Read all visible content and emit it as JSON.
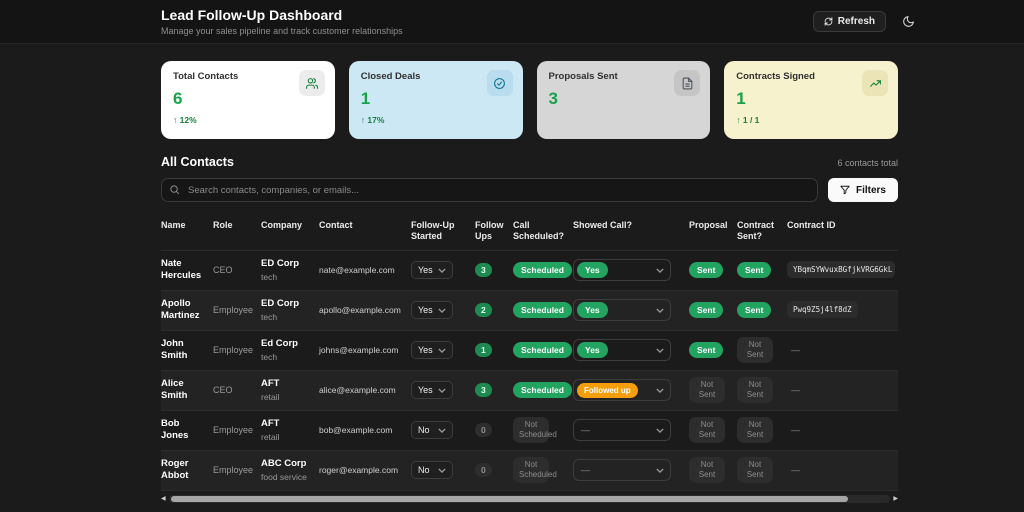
{
  "header": {
    "title": "Lead Follow-Up Dashboard",
    "subtitle": "Manage your sales pipeline and track customer relationships",
    "refresh_label": "Refresh"
  },
  "stats": [
    {
      "label": "Total Contacts",
      "value": "6",
      "delta": "↑ 12%",
      "bg": "#ffffff",
      "icon_bg": "#ececec",
      "icon": "users-icon"
    },
    {
      "label": "Closed Deals",
      "value": "1",
      "delta": "↑ 17%",
      "bg": "#cde8f5",
      "icon_bg": "#b9dcee",
      "icon": "check-circle-icon"
    },
    {
      "label": "Proposals Sent",
      "value": "3",
      "delta": "",
      "bg": "#d6d6d6",
      "icon_bg": "#c5c5c5",
      "icon": "document-icon"
    },
    {
      "label": "Contracts Signed",
      "value": "1",
      "delta": "↑ 1 / 1",
      "bg": "#f6f2cd",
      "icon_bg": "#ebe4b6",
      "icon": "trend-up-icon"
    }
  ],
  "contacts": {
    "section_title": "All Contacts",
    "count_label": "6 contacts total",
    "search_placeholder": "Search contacts, companies, or emails...",
    "filters_label": "Filters"
  },
  "table": {
    "columns": [
      "Name",
      "Role",
      "Company",
      "Contact",
      "Follow-Up Started",
      "Follow Ups",
      "Call Scheduled?",
      "Showed Call?",
      "Proposal",
      "Contract Sent?",
      "Contract ID"
    ],
    "rows": [
      {
        "name": "Nate Hercules",
        "role": "CEO",
        "company": "ED Corp",
        "company_sub": "tech",
        "email": "nate@example.com",
        "followup_started": "Yes",
        "followups": "3",
        "call_scheduled": "Scheduled",
        "showed_call": "Yes",
        "showed_call_variant": "green",
        "proposal": "Sent",
        "contract_sent": "Sent",
        "contract_id": "YBqmSYWvuxBGfjkVRG6GkL"
      },
      {
        "name": "Apollo Martinez",
        "role": "Employee",
        "company": "ED Corp",
        "company_sub": "tech",
        "email": "apollo@example.com",
        "followup_started": "Yes",
        "followups": "2",
        "call_scheduled": "Scheduled",
        "showed_call": "Yes",
        "showed_call_variant": "green",
        "proposal": "Sent",
        "contract_sent": "Sent",
        "contract_id": "Pwq9Z5j4lf8dZ"
      },
      {
        "name": "John Smith",
        "role": "Employee",
        "company": "Ed Corp",
        "company_sub": "tech",
        "email": "johns@example.com",
        "followup_started": "Yes",
        "followups": "1",
        "call_scheduled": "Scheduled",
        "showed_call": "Yes",
        "showed_call_variant": "green",
        "proposal": "Sent",
        "contract_sent": "Not Sent",
        "contract_id": ""
      },
      {
        "name": "Alice Smith",
        "role": "CEO",
        "company": "AFT",
        "company_sub": "retail",
        "email": "alice@example.com",
        "followup_started": "Yes",
        "followups": "3",
        "call_scheduled": "Scheduled",
        "showed_call": "Followed up",
        "showed_call_variant": "orange",
        "proposal": "Not Sent",
        "contract_sent": "Not Sent",
        "contract_id": ""
      },
      {
        "name": "Bob Jones",
        "role": "Employee",
        "company": "AFT",
        "company_sub": "retail",
        "email": "bob@example.com",
        "followup_started": "No",
        "followups": "0",
        "call_scheduled": "Not Scheduled",
        "showed_call": "—",
        "showed_call_variant": "none",
        "proposal": "Not Sent",
        "contract_sent": "Not Sent",
        "contract_id": ""
      },
      {
        "name": "Roger Abbot",
        "role": "Employee",
        "company": "ABC Corp",
        "company_sub": "food service",
        "email": "roger@example.com",
        "followup_started": "No",
        "followups": "0",
        "call_scheduled": "Not Scheduled",
        "showed_call": "—",
        "showed_call_variant": "none",
        "proposal": "Not Sent",
        "contract_sent": "Not Sent",
        "contract_id": ""
      }
    ]
  },
  "icons": {
    "scroll_left": "◀",
    "scroll_right": "▶"
  },
  "colors": {
    "accent_green": "#22a35f",
    "value_green": "#16a34a",
    "badge_orange": "#f59e0b",
    "card_blue": "#cde8f5",
    "card_gray": "#d6d6d6",
    "card_yellow": "#f6f2cd"
  }
}
